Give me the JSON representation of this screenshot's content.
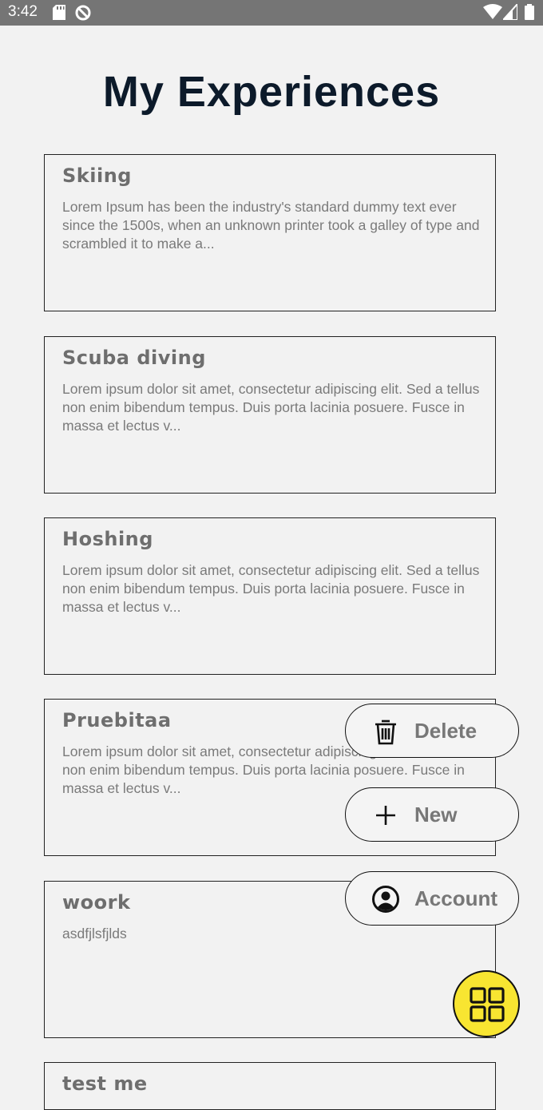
{
  "status_bar": {
    "time": "3:42",
    "icons_left": [
      "sd-card-icon",
      "vpn-icon"
    ],
    "icons_right": [
      "wifi-icon",
      "cell-signal-icon",
      "battery-icon"
    ]
  },
  "page": {
    "title": "My Experiences"
  },
  "experiences": [
    {
      "title": "Skiing",
      "description": "Lorem Ipsum has been the industry's standard dummy text ever since the 1500s, when an unknown printer took a galley of type and scrambled it to make a..."
    },
    {
      "title": "Scuba diving",
      "description": "Lorem ipsum dolor sit amet, consectetur adipiscing elit. Sed a tellus non enim bibendum tempus. Duis porta lacinia posuere. Fusce in massa et lectus v..."
    },
    {
      "title": "Hoshing",
      "description": "Lorem ipsum dolor sit amet, consectetur adipiscing elit. Sed a tellus non enim bibendum tempus. Duis porta lacinia posuere. Fusce in massa et lectus v..."
    },
    {
      "title": "Pruebitaa",
      "description": "Lorem ipsum dolor sit amet, consectetur adipiscing elit. Sed a tellus non enim bibendum tempus. Duis porta lacinia posuere. Fusce in massa et lectus v..."
    },
    {
      "title": "woork",
      "description": "asdfjlsfjlds"
    },
    {
      "title": "test me",
      "description": ""
    }
  ],
  "fab_menu": {
    "delete_label": "Delete",
    "new_label": "New",
    "account_label": "Account",
    "main_icon": "grid-icon",
    "main_color": "#f8e531"
  }
}
